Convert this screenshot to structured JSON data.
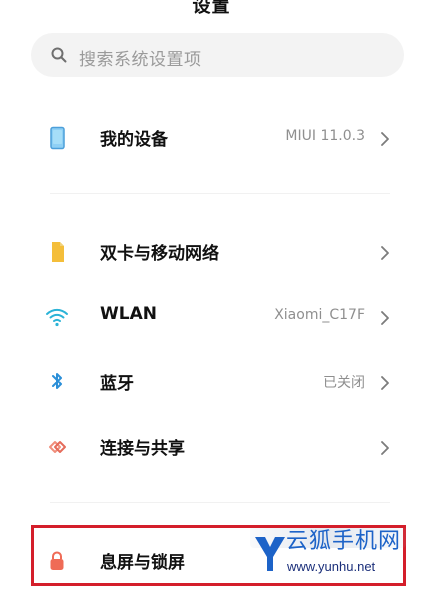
{
  "page": {
    "title": "设置"
  },
  "search": {
    "placeholder": "搜索系统设置项",
    "icon": "search-icon"
  },
  "sections": [
    {
      "items": [
        {
          "label": "我的设备",
          "value": "MIUI 11.0.3",
          "icon": "device-icon",
          "icon_color": "#5aa9e6"
        }
      ]
    },
    {
      "items": [
        {
          "label": "双卡与移动网络",
          "value": "",
          "icon": "sim-card-icon",
          "icon_color": "#f4be3a"
        },
        {
          "label": "WLAN",
          "value": "Xiaomi_C17F",
          "icon": "wifi-icon",
          "icon_color": "#2bb3d7"
        },
        {
          "label": "蓝牙",
          "value": "已关闭",
          "icon": "bluetooth-icon",
          "icon_color": "#2b8fd8"
        },
        {
          "label": "连接与共享",
          "value": "",
          "icon": "connection-sharing-icon",
          "icon_color": "#e56c5b"
        }
      ]
    },
    {
      "items": [
        {
          "label": "息屏与锁屏",
          "value": "",
          "icon": "lock-icon",
          "icon_color": "#ef6b56"
        }
      ]
    }
  ],
  "annotation": {
    "highlight_color": "#d41e2a"
  },
  "watermark": {
    "logo_icon": "yunhu-logo-icon",
    "title": "云狐手机网",
    "url": "www.yunhu.net",
    "title_color": "#1d63c8",
    "url_color": "#1b2f7a"
  }
}
